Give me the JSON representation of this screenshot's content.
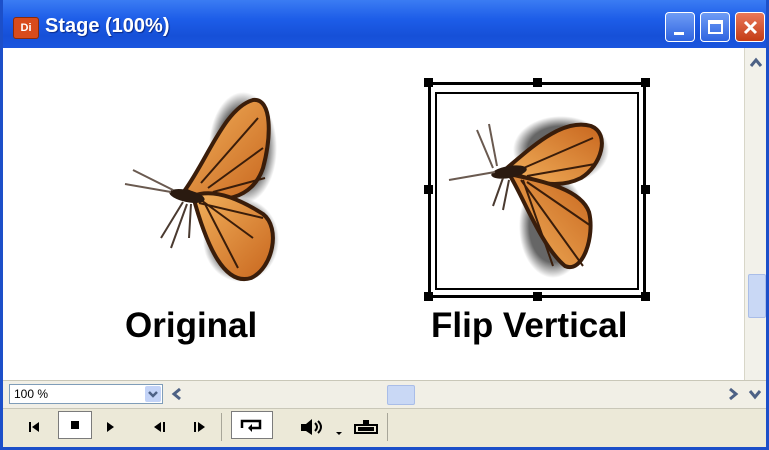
{
  "window": {
    "title": "Stage (100%)",
    "app_icon_text": "Dir",
    "accent": "#1d5de8"
  },
  "stage": {
    "label_original": "Original",
    "label_flip": "Flip Vertical"
  },
  "toolbar": {
    "zoom_value": "100 %"
  },
  "icons": {
    "minimize": "minimize-icon",
    "maximize": "maximize-icon",
    "close": "close-icon",
    "rewind": "rewind-icon",
    "stop": "stop-icon",
    "play": "play-icon",
    "step_back": "step-back-icon",
    "step_forward": "step-forward-icon",
    "loop": "loop-icon",
    "volume": "volume-icon",
    "selected_sprites": "selected-sprites-icon"
  }
}
